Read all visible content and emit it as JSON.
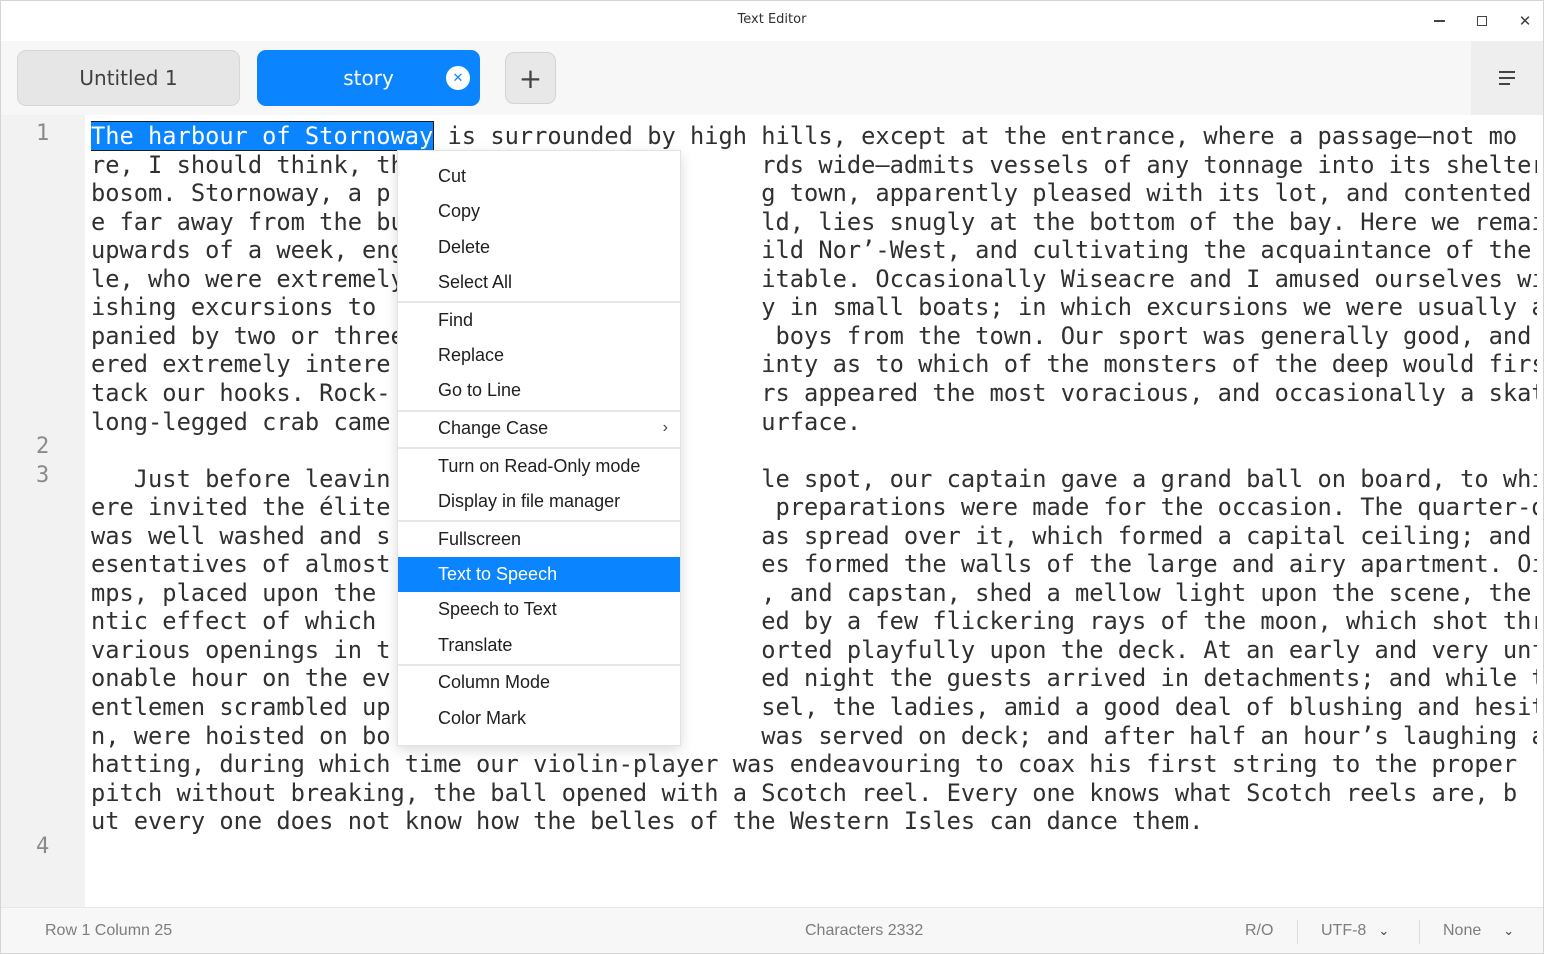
{
  "window": {
    "title": "Text Editor"
  },
  "tabs": [
    {
      "label": "Untitled 1"
    },
    {
      "label": "story",
      "close": "✕"
    }
  ],
  "add_tab_label": "+",
  "gutter": {
    "line_numbers": [
      "1",
      "2",
      "3",
      "4"
    ]
  },
  "editor": {
    "selected_text": "The harbour of Stornoway",
    "rows": [
      " is surrounded by high hills, except at the entrance, where a passage—not mo",
      "re, I should think, th                         rds wide—admits vessels of any tonnage into its sheltering",
      "bosom. Stornoway, a p                          g town, apparently pleased with its lot, and contented to b",
      "e far away from the bu                         ld, lies snugly at the bottom of the bay. Here we remained",
      "upwards of a week, eng                         ild Nor’-West, and cultivating the acquaintance of the peop",
      "le, who were extremely                         itable. Occasionally Wiseacre and I amused ourselves with f",
      "ishing excursions to                           y in small boats; in which excursions we were usually accom",
      "panied by two or three                          boys from the town. Our sport was generally good, and rend",
      "ered extremely intere                          inty as to which of the monsters of the deep would first at",
      "tack our hooks. Rock-                          rs appeared the most voracious, and occasionally a skate or",
      "long-legged crab came                          urface.",
      "",
      "   Just before leavin                          le spot, our captain gave a grand ball on board, to which w",
      "ere invited the élite                           preparations were made for the occasion. The quarter-deck",
      "was well washed and s                          as spread over it, which formed a capital ceiling; and repr",
      "esentatives of almost                          es formed the walls of the large and airy apartment. Oil la",
      "mps, placed upon the                           , and capstan, shed a mellow light upon the scene, the roma",
      "ntic effect of which                           ed by a few flickering rays of the moon, which shot through",
      "various openings in t                          orted playfully upon the deck. At an early and very unfashi",
      "onable hour on the ev                          ed night the guests arrived in detachments; and while the g",
      "entlemen scrambled up                          sel, the ladies, amid a good deal of blushing and hesitatio",
      "n, were hoisted on bo                          was served on deck; and after half an hour’s laughing and c",
      "hatting, during which time our violin-player was endeavouring to coax his first string to the proper",
      "pitch without breaking, the ball opened with a Scotch reel. Every one knows what Scotch reels are, b",
      "ut every one does not know how the belles of the Western Isles can dance them."
    ]
  },
  "context_menu": {
    "groups": [
      [
        "Cut",
        "Copy",
        "Delete",
        "Select All"
      ],
      [
        "Find",
        "Replace",
        "Go to Line"
      ],
      [
        "Change Case"
      ],
      [
        "Turn on Read-Only mode",
        "Display in file manager"
      ],
      [
        "Fullscreen",
        "Text to Speech",
        "Speech to Text",
        "Translate"
      ],
      [
        "Column Mode",
        "Color Mark"
      ]
    ],
    "highlighted": "Text to Speech",
    "submenu_arrow": "›"
  },
  "statusbar": {
    "position": "Row 1  Column 25",
    "characters": "Characters 2332",
    "readonly": "R/O",
    "encoding": "UTF-8",
    "highlight": "None"
  }
}
